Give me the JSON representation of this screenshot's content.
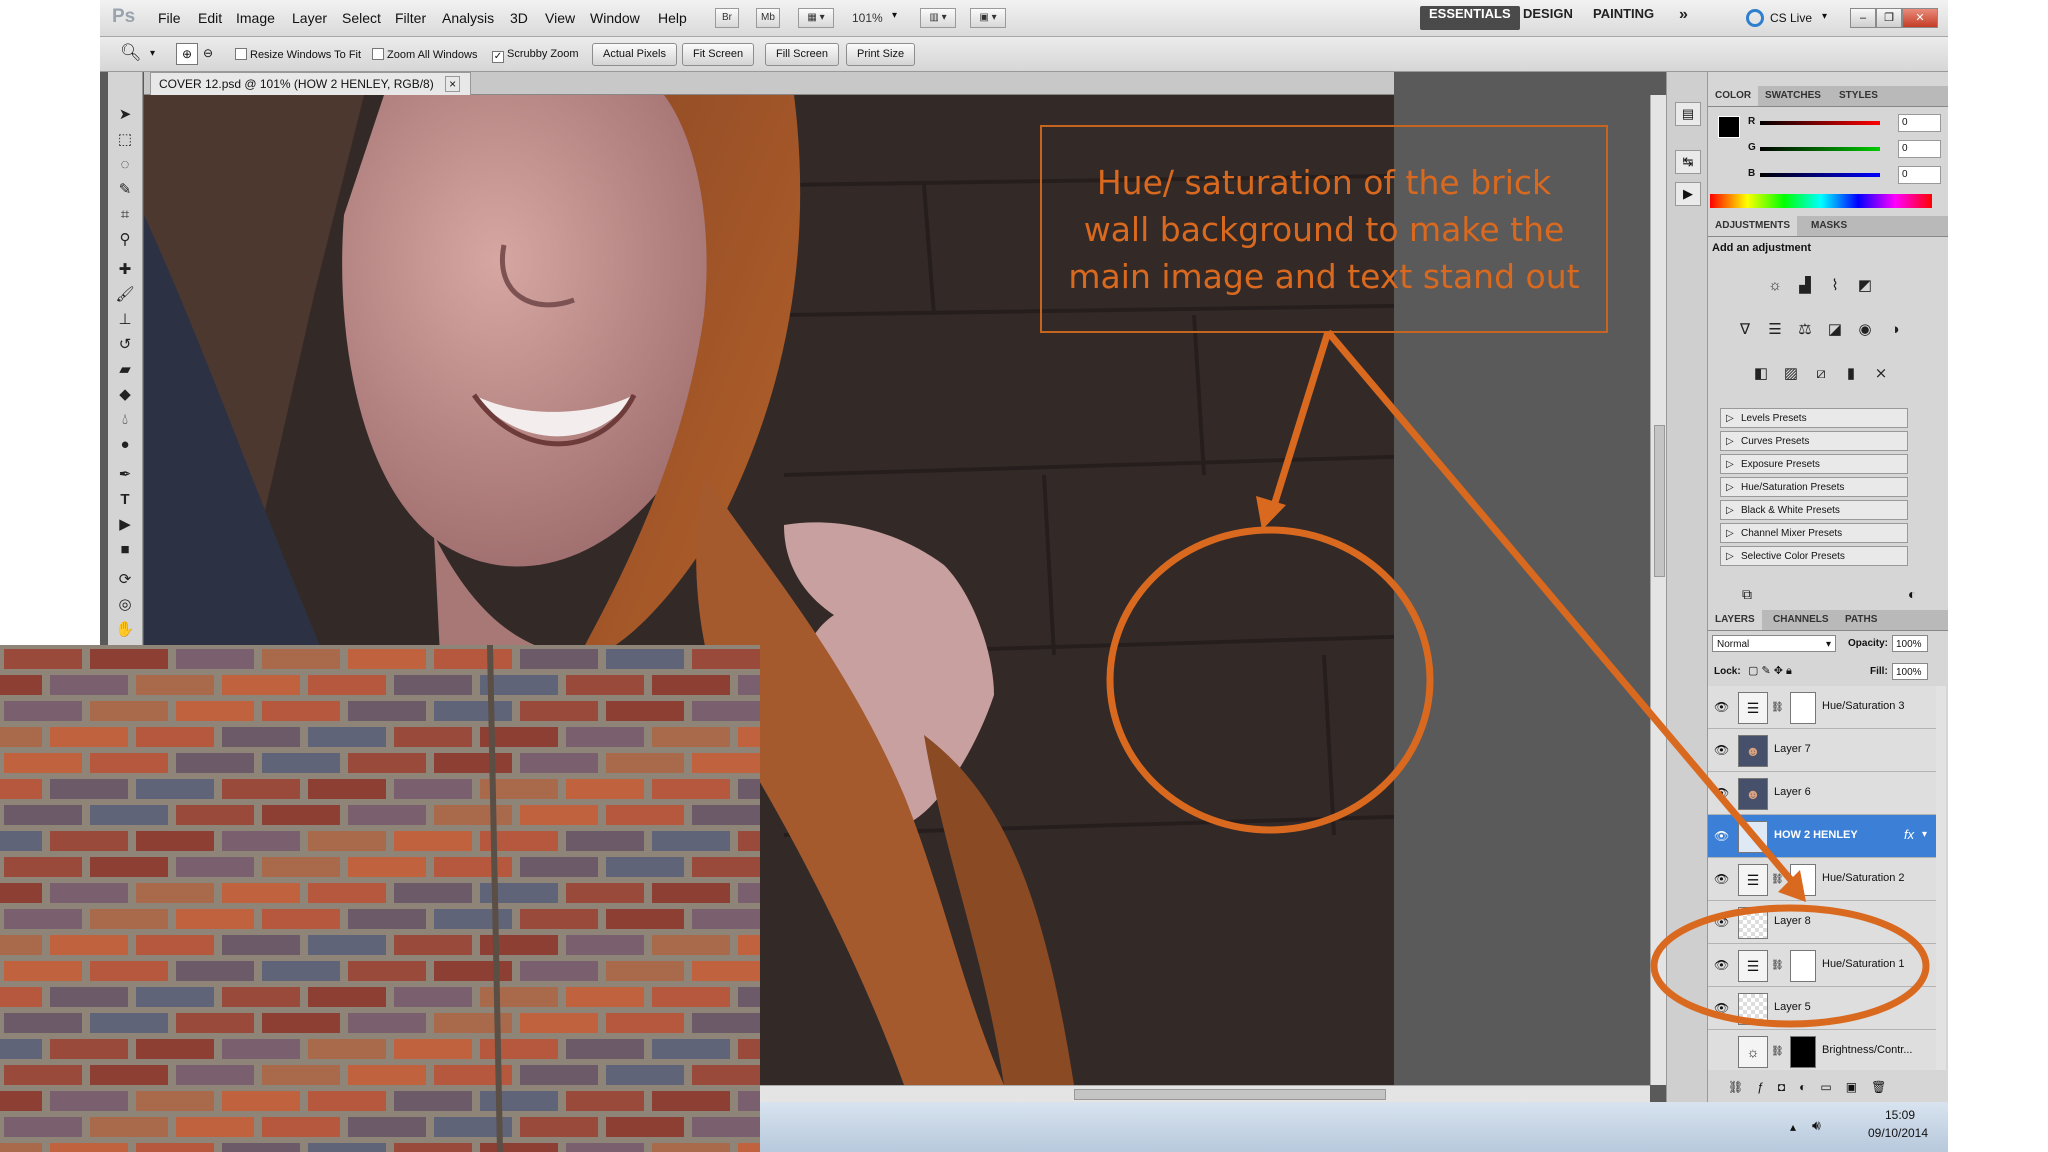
{
  "app": {
    "logo": "Ps",
    "menus": [
      "File",
      "Edit",
      "Image",
      "Layer",
      "Select",
      "Filter",
      "Analysis",
      "3D",
      "View",
      "Window",
      "Help"
    ],
    "zoom": "101%",
    "mini_buttons": [
      "Br",
      "Mb"
    ]
  },
  "workspaces": [
    "ESSENTIALS",
    "DESIGN",
    "PAINTING"
  ],
  "more_glyph": "»",
  "cslive": "CS Live",
  "window_controls": [
    "–",
    "❐",
    "✕"
  ],
  "options": {
    "checks": [
      {
        "label": "Resize Windows To Fit",
        "checked": false
      },
      {
        "label": "Zoom All Windows",
        "checked": false
      },
      {
        "label": "Scrubby Zoom",
        "checked": true
      }
    ],
    "buttons": [
      "Actual Pixels",
      "Fit Screen",
      "Fill Screen",
      "Print Size"
    ]
  },
  "document": {
    "tab_title": "COVER 12.psd @ 101% (HOW 2 HENLEY, RGB/8)",
    "close": "×"
  },
  "color_panel": {
    "tabs": [
      "COLOR",
      "SWATCHES",
      "STYLES"
    ],
    "channels": [
      {
        "label": "R",
        "value": "0"
      },
      {
        "label": "G",
        "value": "0"
      },
      {
        "label": "B",
        "value": "0"
      }
    ]
  },
  "adjustments_panel": {
    "tabs": [
      "ADJUSTMENTS",
      "MASKS"
    ],
    "heading": "Add an adjustment",
    "presets": [
      "Levels Presets",
      "Curves Presets",
      "Exposure Presets",
      "Hue/Saturation Presets",
      "Black & White Presets",
      "Channel Mixer Presets",
      "Selective Color Presets"
    ]
  },
  "layers_panel": {
    "tabs": [
      "LAYERS",
      "CHANNELS",
      "PATHS"
    ],
    "blend_mode": "Normal",
    "opacity_label": "Opacity:",
    "opacity": "100%",
    "lock_label": "Lock:",
    "fill_label": "Fill:",
    "fill": "100%",
    "layers": [
      {
        "name": "Hue/Saturation 3",
        "adjust": true,
        "visible": true,
        "selected": false,
        "fx": ""
      },
      {
        "name": "Layer 7",
        "adjust": false,
        "visible": true,
        "selected": false,
        "fx": ""
      },
      {
        "name": "Layer 6",
        "adjust": false,
        "visible": true,
        "selected": false,
        "fx": ""
      },
      {
        "name": "HOW 2 HENLEY",
        "adjust": false,
        "visible": true,
        "selected": true,
        "fx": "fx"
      },
      {
        "name": "Hue/Saturation 2",
        "adjust": true,
        "visible": true,
        "selected": false,
        "fx": ""
      },
      {
        "name": "Layer 8",
        "adjust": false,
        "visible": true,
        "selected": false,
        "fx": ""
      },
      {
        "name": "Hue/Saturation 1",
        "adjust": true,
        "visible": true,
        "selected": false,
        "fx": ""
      },
      {
        "name": "Layer 5",
        "adjust": false,
        "visible": true,
        "selected": false,
        "fx": ""
      },
      {
        "name": "Brightness/Contr...",
        "adjust": true,
        "visible": false,
        "selected": false,
        "fx": ""
      }
    ]
  },
  "taskbar": {
    "time": "15:09",
    "date": "09/10/2014"
  },
  "annotation": {
    "text": "Hue/ saturation of the brick wall background to make the main image and text stand out",
    "color": "#d9691f"
  }
}
